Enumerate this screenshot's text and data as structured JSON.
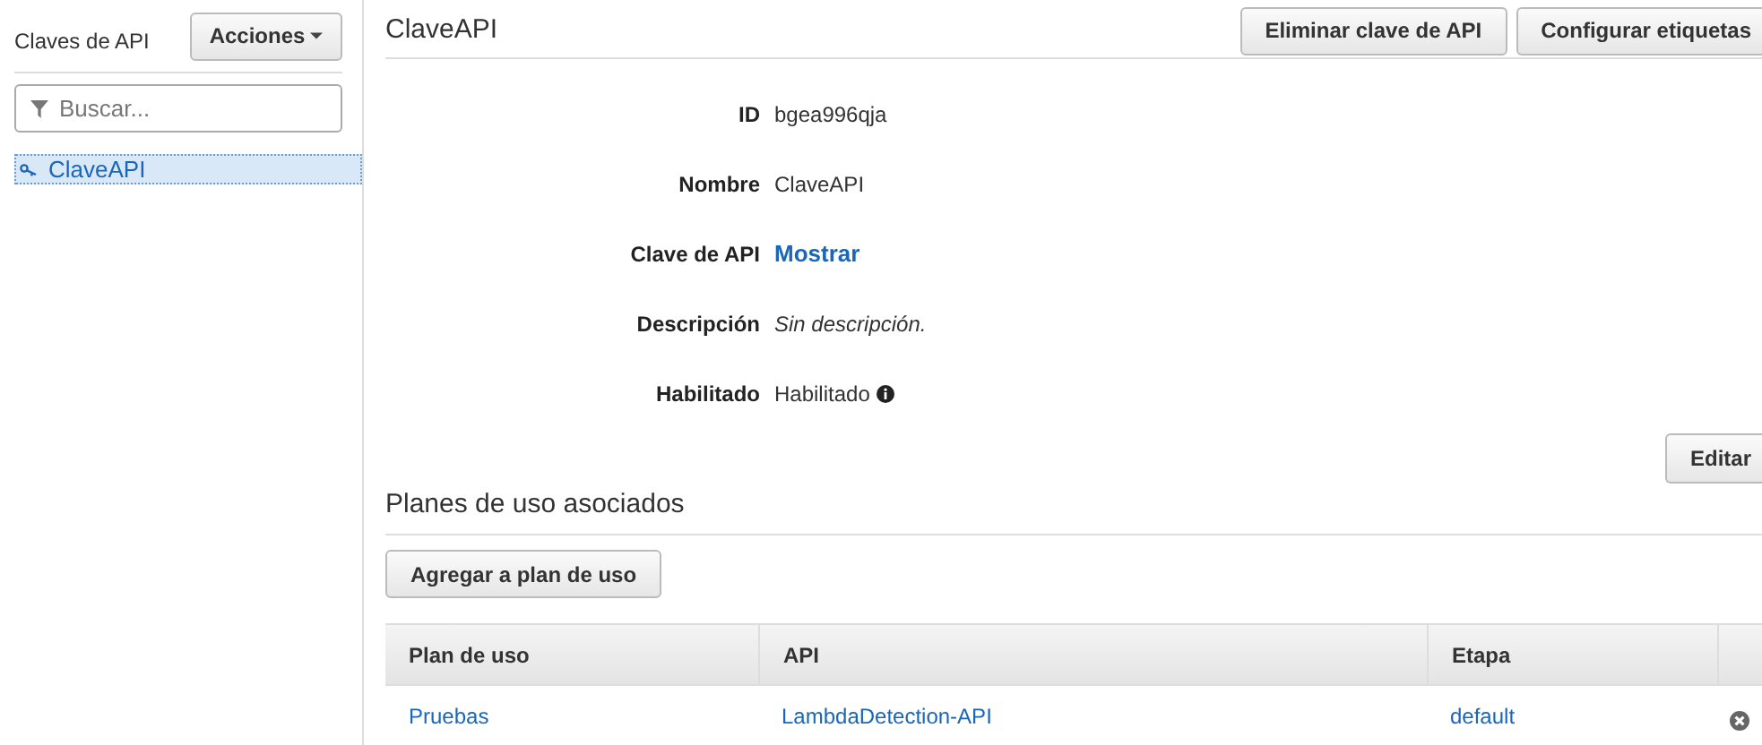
{
  "sidebar": {
    "title": "Claves de API",
    "actions_button": "Acciones",
    "search": {
      "placeholder": "Buscar..."
    },
    "items": [
      {
        "label": "ClaveAPI",
        "selected": true
      }
    ]
  },
  "detail": {
    "title": "ClaveAPI",
    "buttons": [
      "Eliminar clave de API",
      "Configurar etiquetas"
    ],
    "fields": [
      {
        "kind": "text",
        "label": "ID",
        "value": "bgea996qja"
      },
      {
        "kind": "text",
        "label": "Nombre",
        "value": "ClaveAPI"
      },
      {
        "kind": "link",
        "label": "Clave de API",
        "value": "Mostrar"
      },
      {
        "kind": "italic",
        "label": "Descripción",
        "value": "Sin descripción."
      },
      {
        "kind": "info",
        "label": "Habilitado",
        "value": "Habilitado"
      }
    ],
    "edit_button": "Editar"
  },
  "usage_plans": {
    "title": "Planes de uso asociados",
    "add_button": "Agregar a plan de uso",
    "columns": [
      "Plan de uso",
      "API",
      "Etapa"
    ],
    "rows": [
      {
        "plan": "Pruebas",
        "api": "LambdaDetection-API",
        "stage": "default"
      }
    ]
  }
}
